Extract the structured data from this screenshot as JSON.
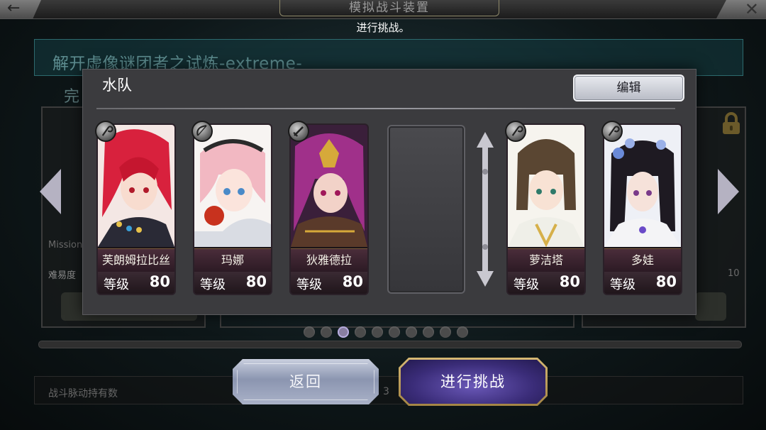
{
  "header": {
    "back_glyph": "←",
    "close_glyph": "✕",
    "screen_title": "模拟战斗装置",
    "notice": "进行挑战。"
  },
  "background": {
    "quest_title": "解开虚像谜团者之试炼-extreme-",
    "complete_label": "完",
    "mission_label": "Mission",
    "difficulty_label": "难易度",
    "right_number": "10",
    "battle_pulse_label": "战斗脉动持有数",
    "battle_pulse_value": "3",
    "pager": {
      "count": 10,
      "active_index": 2
    }
  },
  "party": {
    "title": "水队",
    "edit_label": "编辑",
    "members": [
      {
        "name": "芙朗姆拉比丝",
        "level_label": "等级",
        "level": "80",
        "weapon": "staff-icon"
      },
      {
        "name": "玛娜",
        "level_label": "等级",
        "level": "80",
        "weapon": "bow-icon"
      },
      {
        "name": "狄雅德拉",
        "level_label": "等级",
        "level": "80",
        "weapon": "sword-icon"
      },
      {
        "name": "萝洁塔",
        "level_label": "等级",
        "level": "80",
        "weapon": "staff-icon"
      },
      {
        "name": "多娃",
        "level_label": "等级",
        "level": "80",
        "weapon": "staff-icon"
      }
    ],
    "empty_slot_count": 1
  },
  "buttons": {
    "back_label": "返回",
    "challenge_label": "进行挑战"
  },
  "colors": {
    "modal_bg": "#3b3b3e",
    "challenge_accent": "#3a2c78",
    "challenge_border": "#d6b873",
    "back_accent": "#8b95b0"
  }
}
